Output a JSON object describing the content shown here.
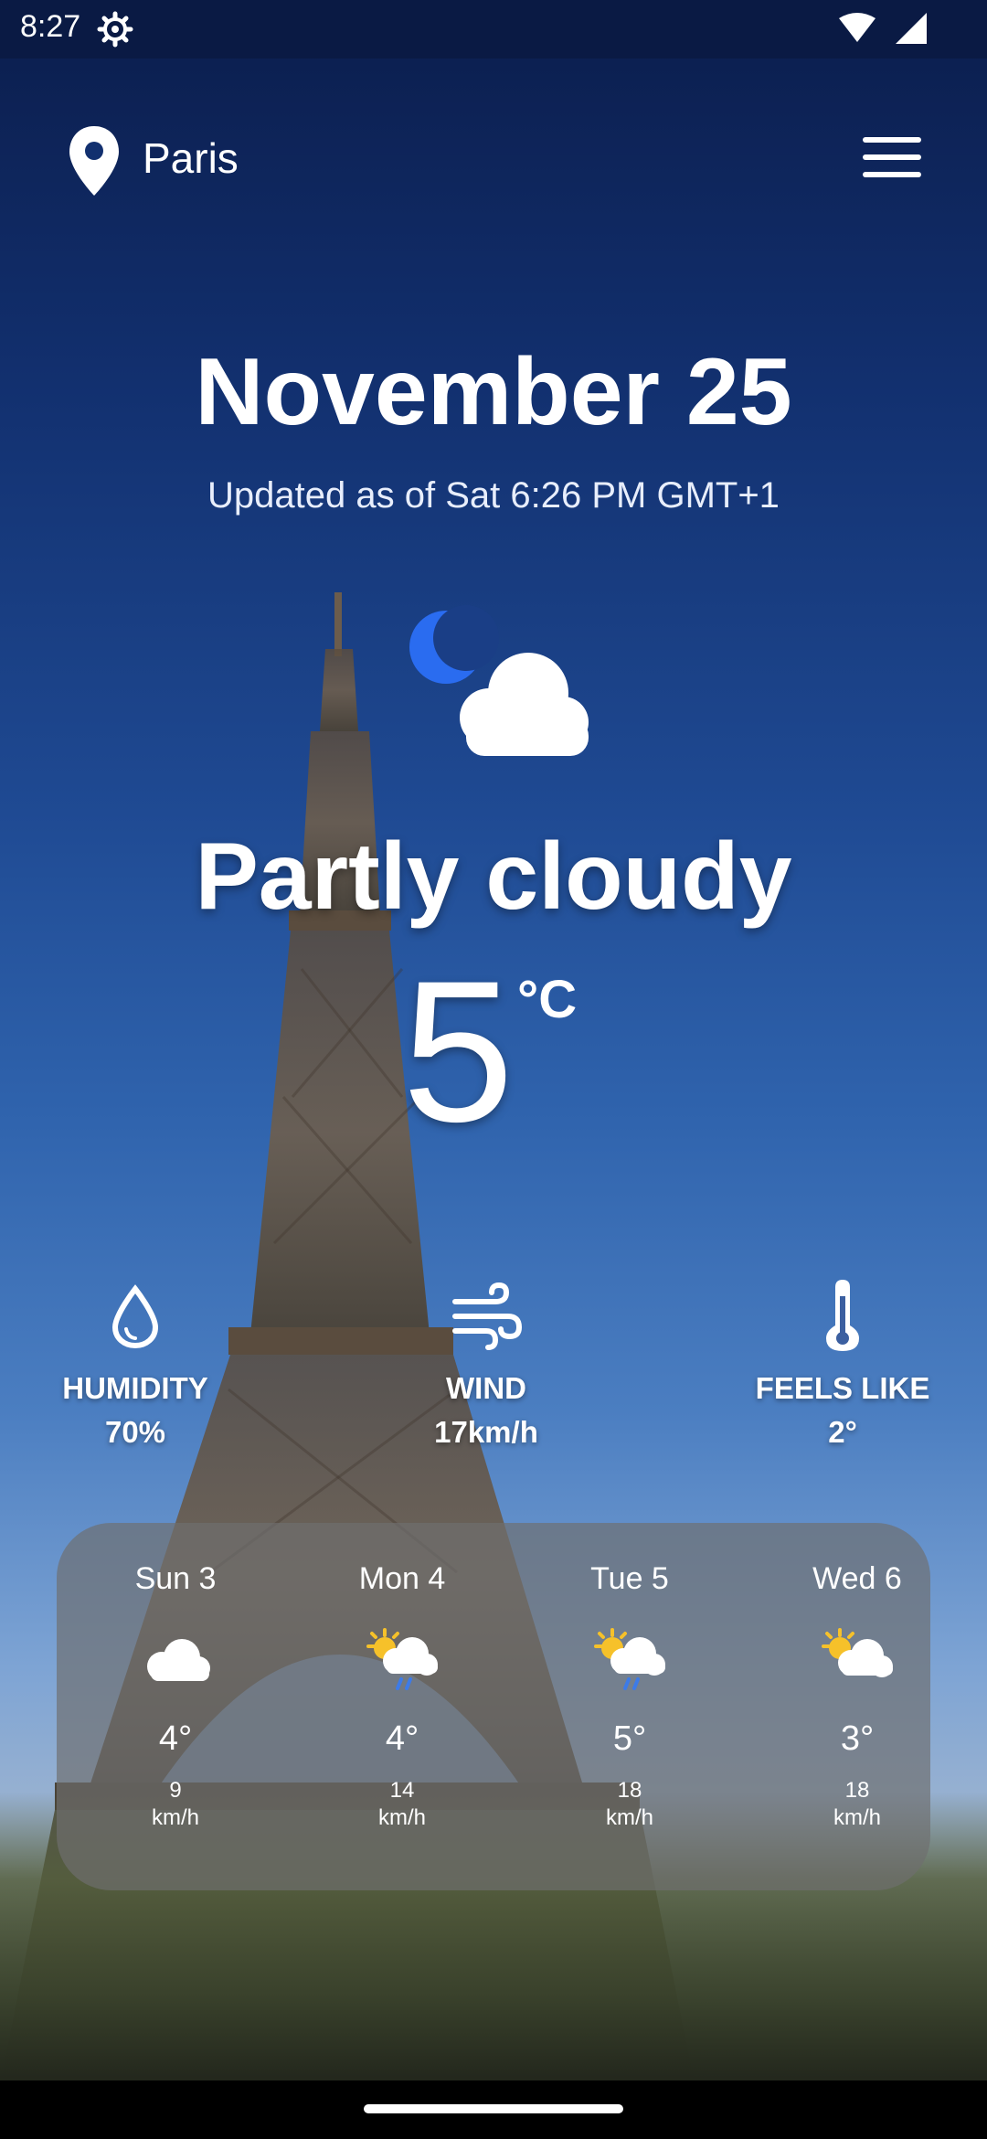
{
  "status_bar": {
    "time": "8:27"
  },
  "header": {
    "city": "Paris"
  },
  "main": {
    "date": "November 25",
    "updated": "Updated as of Sat 6:26 PM GMT+1",
    "condition": "Partly cloudy",
    "temperature": "5",
    "unit": "°C",
    "condition_icon": "moon-cloud-icon"
  },
  "stats": [
    {
      "icon": "droplet-icon",
      "label": "HUMIDITY",
      "value": "70%"
    },
    {
      "icon": "wind-icon",
      "label": "WIND",
      "value": "17km/h"
    },
    {
      "icon": "thermometer-icon",
      "label": "FEELS LIKE",
      "value": "2°"
    }
  ],
  "forecast": [
    {
      "day": "Sun 3",
      "icon": "cloud-icon",
      "temp": "4°",
      "wind_value": "9",
      "wind_unit": "km/h"
    },
    {
      "day": "Mon 4",
      "icon": "sun-cloud-rain-icon",
      "temp": "4°",
      "wind_value": "14",
      "wind_unit": "km/h"
    },
    {
      "day": "Tue 5",
      "icon": "sun-cloud-rain-icon",
      "temp": "5°",
      "wind_value": "18",
      "wind_unit": "km/h"
    },
    {
      "day": "Wed 6",
      "icon": "sun-cloud-icon",
      "temp": "3°",
      "wind_value": "18",
      "wind_unit": "km/h"
    }
  ],
  "colors": {
    "sky_top": "#0b1d4c",
    "sky_mid": "#2f63ad",
    "moon": "#2a6cf0",
    "sun": "#f6c12a",
    "rain": "#3d7be8",
    "panel": "#6e6e6e"
  }
}
